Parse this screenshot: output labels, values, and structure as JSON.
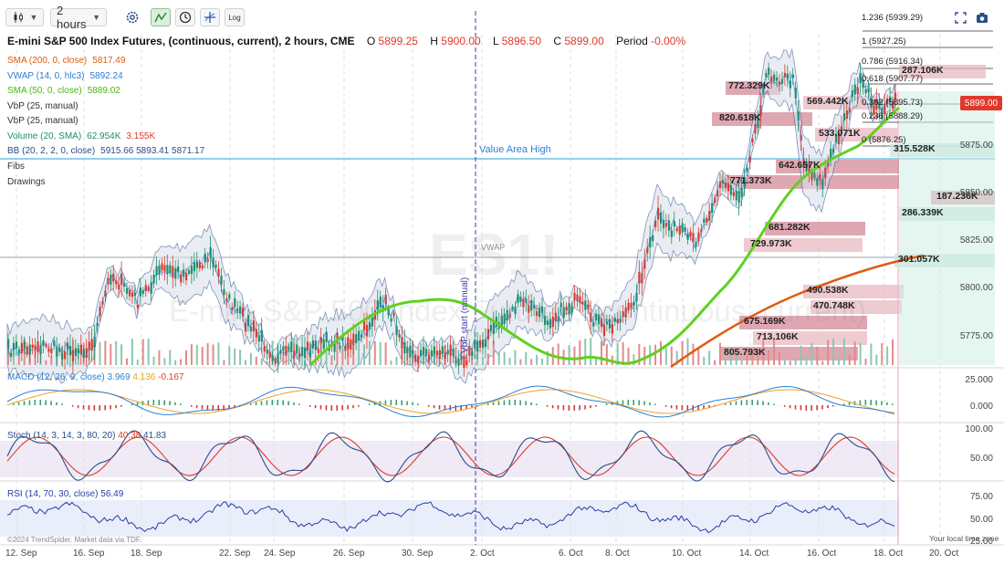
{
  "toolbar": {
    "bar_style_icon": "candlestick-icon",
    "interval": "2 hours",
    "settings_icon": "gear-icon",
    "indicators_icon": "indicator-icon",
    "replay_icon": "clock-icon",
    "crosshair_icon": "crosshair-icon",
    "log_label": "Log",
    "fullscreen_icon": "fullscreen-icon",
    "snapshot_icon": "camera-icon"
  },
  "header": {
    "title": "E-mini S&P 500 Index Futures, (continuous, current), 2 hours, CME",
    "o_label": "O",
    "o": "5899.25",
    "h_label": "H",
    "h": "5900.00",
    "l_label": "L",
    "l": "5896.50",
    "c_label": "C",
    "c": "5899.00",
    "period_label": "Period",
    "period": "-0.00%"
  },
  "legend": [
    {
      "label": "SMA (200, 0, close)",
      "value": "5817.49",
      "color": "#e05a10"
    },
    {
      "label": "VWAP (14, 0, hlc3)",
      "value": "5892.24",
      "color": "#2a7fd4"
    },
    {
      "label": "SMA (50, 0, close)",
      "value": "5889.02",
      "color": "#5fd11e"
    },
    {
      "label": "VbP (25, manual)",
      "value": "",
      "color": "#333333"
    },
    {
      "label": "VbP (25, manual)",
      "value": "",
      "color": "#333333"
    },
    {
      "label": "Volume (20, SMA)",
      "value": "62.954K",
      "value2": "3.155K",
      "color": "#1f8f6a"
    },
    {
      "label": "BB (20, 2, 2, 0, close)",
      "value": "5915.66 5893.41 5871.17",
      "color": "#2a4d8a"
    },
    {
      "label": "Fibs",
      "value": "",
      "color": "#333333"
    },
    {
      "label": "Drawings",
      "value": "",
      "color": "#333333"
    }
  ],
  "watermark": {
    "symbol": "ES1!",
    "name": "E-mini S&P 500 Index Futures, (continuous, current)"
  },
  "annotations": {
    "value_area_high": "Value Area High",
    "vwap_tag": "VWAP",
    "vbp_start": "VbP start (manual)"
  },
  "fib_levels": [
    {
      "label": "1.236 (5939.29)"
    },
    {
      "label": "1 (5927.25)"
    },
    {
      "label": "0.786 (5916.34)"
    },
    {
      "label": "0.618 (5907.77)"
    },
    {
      "label": "0.382 (5895.73)"
    },
    {
      "label": "0.236 (5888.29)"
    },
    {
      "label": "0 (5876.25)"
    }
  ],
  "last_price": "5899.00",
  "price_axis": [
    "5875.00",
    "5850.00",
    "5825.00",
    "5800.00",
    "5775.00"
  ],
  "vbp_labels": [
    "772.329K",
    "569.442K",
    "820.618K",
    "533.071K",
    "287.106K",
    "642.657K",
    "315.528K",
    "771.373K",
    "187.236K",
    "286.339K",
    "681.282K",
    "729.973K",
    "301.057K",
    "490.538K",
    "470.748K",
    "675.169K",
    "713.106K",
    "805.793K"
  ],
  "macd": {
    "label": "MACD (12, 26, 9, close)",
    "v1": "3.969",
    "v2": "4.136",
    "v3": "-0.167",
    "axis": [
      "25.000",
      "0.000"
    ]
  },
  "stoch": {
    "label": "Stoch (14, 3, 14, 3, 80, 20)",
    "v1": "40.38",
    "v2": "41.83",
    "axis": [
      "100.00",
      "50.00"
    ]
  },
  "rsi": {
    "label": "RSI (14, 70, 30, close)",
    "v1": "56.49",
    "axis": [
      "75.00",
      "50.00",
      "25.00"
    ]
  },
  "footer": {
    "credit": "©2024 TrendSpider. Market data via TDF.",
    "timezone": "Your local time zone"
  },
  "date_axis": [
    "12. Sep",
    "16. Sep",
    "18. Sep",
    "22. Sep",
    "24. Sep",
    "26. Sep",
    "30. Sep",
    "2. Oct",
    "6. Oct",
    "8. Oct",
    "10. Oct",
    "14. Oct",
    "16. Oct",
    "18. Oct",
    "20. Oct"
  ],
  "colors": {
    "up": "#1f8f6a",
    "down": "#e0392b",
    "sma200": "#e05a10",
    "sma50": "#5fd11e",
    "vwap": "#2a7fd4",
    "bb": "#2a4d8a",
    "stoch_k": "#2a4d8a",
    "stoch_d": "#e0392b",
    "rsi": "#2a3ba8",
    "macd": "#2a7fd4",
    "signal": "#f0a020"
  }
}
